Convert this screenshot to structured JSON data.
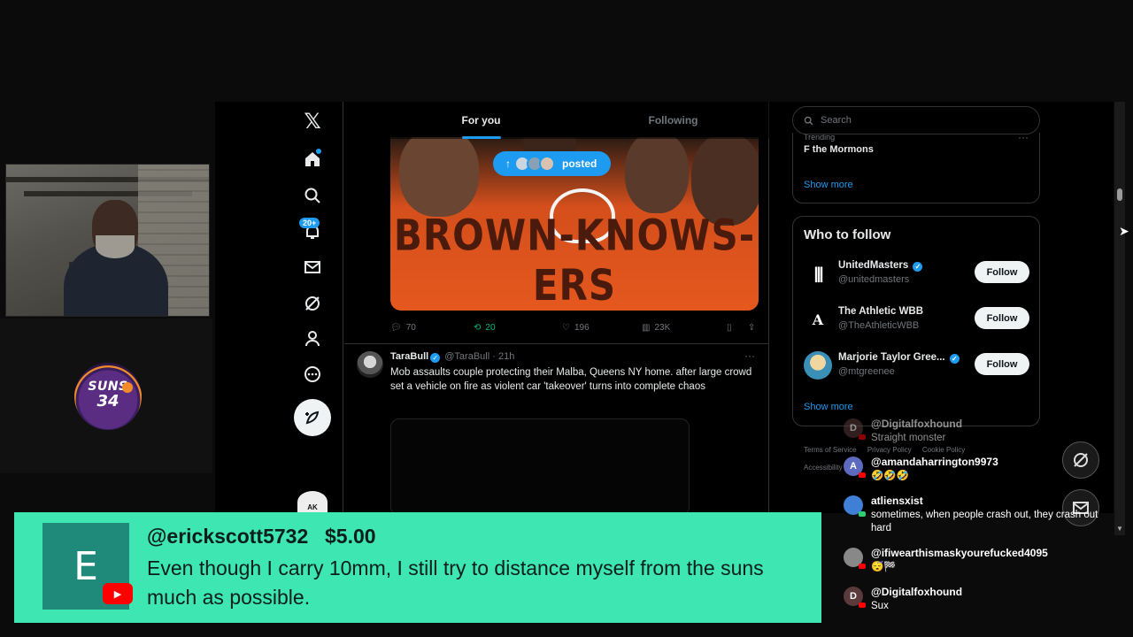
{
  "x": {
    "tabs": [
      {
        "label": "For you",
        "active": true
      },
      {
        "label": "Following",
        "active": false
      }
    ],
    "nav": {
      "notifications_badge": "20+",
      "avatar_text": "AK"
    },
    "featured_post": {
      "image_headline": "BROWN-KNOWS-ERS",
      "posted_pill": "posted",
      "stats": {
        "replies": "70",
        "reposts": "20",
        "likes": "196",
        "views": "23K"
      }
    },
    "tweet": {
      "name": "TaraBull",
      "handle": "@TaraBull",
      "time": "· 21h",
      "text": "Mob assaults couple protecting their Malba, Queens NY home. after large crowd set a vehicle on fire as violent car 'takeover' turns into complete chaos"
    },
    "search": {
      "placeholder": "Search"
    },
    "trending": {
      "meta": "Trending",
      "name": "F the Mormons",
      "show_more": "Show more"
    },
    "who_to_follow": {
      "title": "Who to follow",
      "accounts": [
        {
          "name": "UnitedMasters",
          "handle": "@unitedmasters",
          "follow": "Follow",
          "avatar": "|||"
        },
        {
          "name": "The Athletic WBB",
          "handle": "@TheAthleticWBB",
          "follow": "Follow",
          "avatar": "A"
        },
        {
          "name": "Marjorie Taylor Gree...",
          "handle": "@mtgreenee",
          "follow": "Follow",
          "avatar": ""
        }
      ],
      "show_more": "Show more"
    },
    "footer": [
      "Terms of Service",
      "Privacy Policy",
      "Cookie Policy",
      "Accessibility"
    ]
  },
  "stream": {
    "badge": {
      "team": "SUNS",
      "number": "34"
    }
  },
  "chat": [
    {
      "name": "@Digitalfoxhound",
      "text": "Straight monster",
      "avatar": "D",
      "color": "#5a3a3a"
    },
    {
      "name": "@amandaharrington9973",
      "text": "🤣🤣🤣",
      "avatar": "A",
      "color": "#5c6bc0"
    },
    {
      "name": "atliensxist",
      "text": "sometimes, when people crash out, they crash out hard",
      "avatar": "",
      "color": "#3f7fd6"
    },
    {
      "name": "@ifiwearthismaskyourefucked4095",
      "text": "😴🏁",
      "avatar": "",
      "color": "#888888"
    },
    {
      "name": "@Digitalfoxhound",
      "text": "Sux",
      "avatar": "D",
      "color": "#5a3a3a"
    }
  ],
  "superchat": {
    "name": "@erickscott5732",
    "amount": "$5.00",
    "message": "Even though I carry 10mm, I still try to distance myself from the suns much as possible.",
    "avatar_letter": "E",
    "color": "#3ee6b2"
  }
}
